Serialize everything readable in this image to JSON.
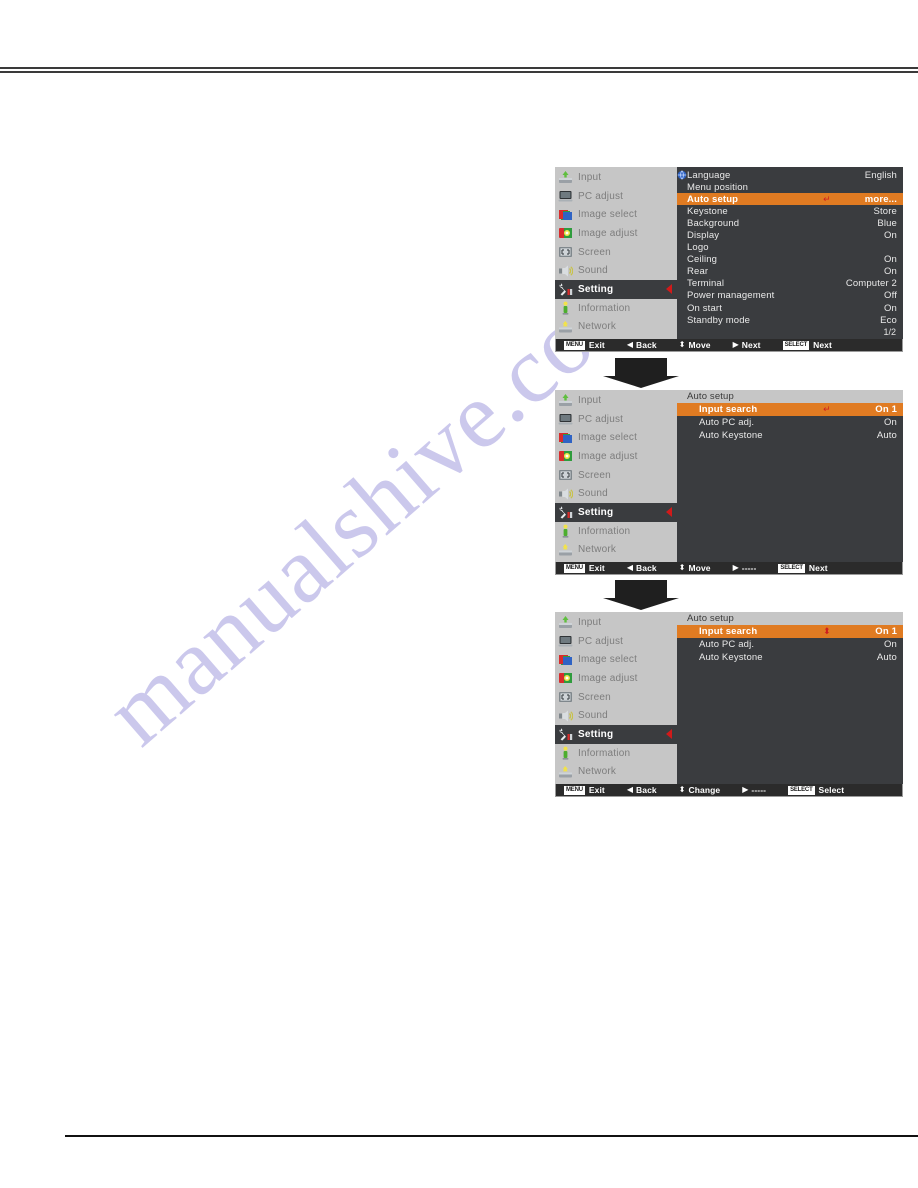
{
  "watermark": {
    "text": "manualshive.com",
    "color": "#c9c6ec"
  },
  "sidebar": {
    "items": [
      {
        "label": "Input",
        "icon": "input-icon",
        "active": false
      },
      {
        "label": "PC adjust",
        "icon": "pc-adjust-icon",
        "active": false
      },
      {
        "label": "Image select",
        "icon": "image-select-icon",
        "active": false
      },
      {
        "label": "Image adjust",
        "icon": "image-adjust-icon",
        "active": false
      },
      {
        "label": "Screen",
        "icon": "screen-icon",
        "active": false
      },
      {
        "label": "Sound",
        "icon": "sound-icon",
        "active": false
      },
      {
        "label": "Setting",
        "icon": "setting-icon",
        "active": true
      },
      {
        "label": "Information",
        "icon": "information-icon",
        "active": false
      },
      {
        "label": "Network",
        "icon": "network-icon",
        "active": false
      }
    ]
  },
  "colors": {
    "highlight": "#e07b22",
    "panel": "#3a3c3f",
    "sidebar": "#c6c6c6",
    "accent_red": "#d11a1a",
    "footer": "#2b2b2b"
  },
  "menu_setting": {
    "page_indicator": "1/2",
    "rows": [
      {
        "label": "Language",
        "value": "English",
        "glyph": "",
        "highlight": false,
        "icon": "globe-icon"
      },
      {
        "label": "Menu position",
        "value": "",
        "glyph": "",
        "highlight": false
      },
      {
        "label": "Auto setup",
        "value": "more...",
        "glyph": "↵",
        "highlight": true
      },
      {
        "label": "Keystone",
        "value": "Store",
        "glyph": "",
        "highlight": false
      },
      {
        "label": "Background",
        "value": "Blue",
        "glyph": "",
        "highlight": false
      },
      {
        "label": "Display",
        "value": "On",
        "glyph": "",
        "highlight": false
      },
      {
        "label": "Logo",
        "value": "",
        "glyph": "",
        "highlight": false
      },
      {
        "label": "Ceiling",
        "value": "On",
        "glyph": "",
        "highlight": false
      },
      {
        "label": "Rear",
        "value": "On",
        "glyph": "",
        "highlight": false
      },
      {
        "label": "Terminal",
        "value": "Computer 2",
        "glyph": "",
        "highlight": false
      },
      {
        "label": "Power management",
        "value": "Off",
        "glyph": "",
        "highlight": false
      },
      {
        "label": "On start",
        "value": "On",
        "glyph": "",
        "highlight": false
      },
      {
        "label": "Standby mode",
        "value": "Eco",
        "glyph": "",
        "highlight": false
      }
    ],
    "footer": [
      {
        "chip": "MENU",
        "glyph": "",
        "label": "Exit"
      },
      {
        "chip": "",
        "glyph": "◀",
        "label": "Back"
      },
      {
        "chip": "",
        "glyph": "⬍",
        "label": "Move"
      },
      {
        "chip": "",
        "glyph": "▶",
        "label": "Next"
      },
      {
        "chip": "SELECT",
        "glyph": "",
        "label": "Next"
      }
    ]
  },
  "menu_autosetup_move": {
    "title": "Auto setup",
    "rows": [
      {
        "label": "Input search",
        "value": "On 1",
        "glyph": "↵",
        "highlight": true
      },
      {
        "label": "Auto PC adj.",
        "value": "On",
        "glyph": "",
        "highlight": false
      },
      {
        "label": "Auto Keystone",
        "value": "Auto",
        "glyph": "",
        "highlight": false
      }
    ],
    "footer": [
      {
        "chip": "MENU",
        "glyph": "",
        "label": "Exit"
      },
      {
        "chip": "",
        "glyph": "◀",
        "label": "Back"
      },
      {
        "chip": "",
        "glyph": "⬍",
        "label": "Move"
      },
      {
        "chip": "",
        "glyph": "▶",
        "label": "-----"
      },
      {
        "chip": "SELECT",
        "glyph": "",
        "label": "Next"
      }
    ]
  },
  "menu_autosetup_change": {
    "title": "Auto setup",
    "rows": [
      {
        "label": "Input search",
        "value": "On 1",
        "glyph": "⬍",
        "highlight": true
      },
      {
        "label": "Auto PC adj.",
        "value": "On",
        "glyph": "",
        "highlight": false
      },
      {
        "label": "Auto Keystone",
        "value": "Auto",
        "glyph": "",
        "highlight": false
      }
    ],
    "footer": [
      {
        "chip": "MENU",
        "glyph": "",
        "label": "Exit"
      },
      {
        "chip": "",
        "glyph": "◀",
        "label": "Back"
      },
      {
        "chip": "",
        "glyph": "⬍",
        "label": "Change"
      },
      {
        "chip": "",
        "glyph": "▶",
        "label": "-----"
      },
      {
        "chip": "SELECT",
        "glyph": "",
        "label": "Select"
      }
    ]
  },
  "flow": {
    "arrow1": "down-arrow",
    "arrow2": "down-arrow"
  }
}
